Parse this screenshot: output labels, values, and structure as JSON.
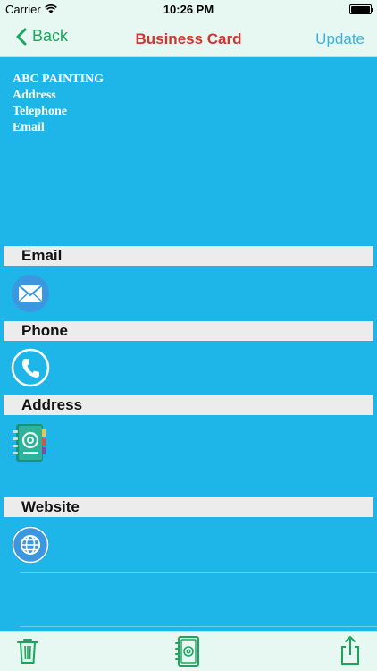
{
  "status_bar": {
    "carrier": "Carrier",
    "time": "10:26 PM"
  },
  "nav": {
    "back_label": "Back",
    "title": "Business Card",
    "update_label": "Update"
  },
  "card": {
    "lines": [
      "ABC PAINTING",
      "Address",
      "Telephone",
      "Email"
    ]
  },
  "sections": {
    "email": {
      "label": "Email",
      "icon": "envelope-icon"
    },
    "phone": {
      "label": "Phone",
      "icon": "phone-icon"
    },
    "address": {
      "label": "Address",
      "icon": "address-book-icon"
    },
    "website": {
      "label": "Website",
      "icon": "globe-icon"
    }
  },
  "toolbar": {
    "icons": [
      "trash-icon",
      "contact-book-icon",
      "share-icon"
    ]
  },
  "colors": {
    "background": "#1eb6e8",
    "nav_bg": "#e6f8f1",
    "title": "#d0352f",
    "back": "#1aa75d",
    "update": "#3fb0db",
    "header_bg": "#ececec"
  }
}
